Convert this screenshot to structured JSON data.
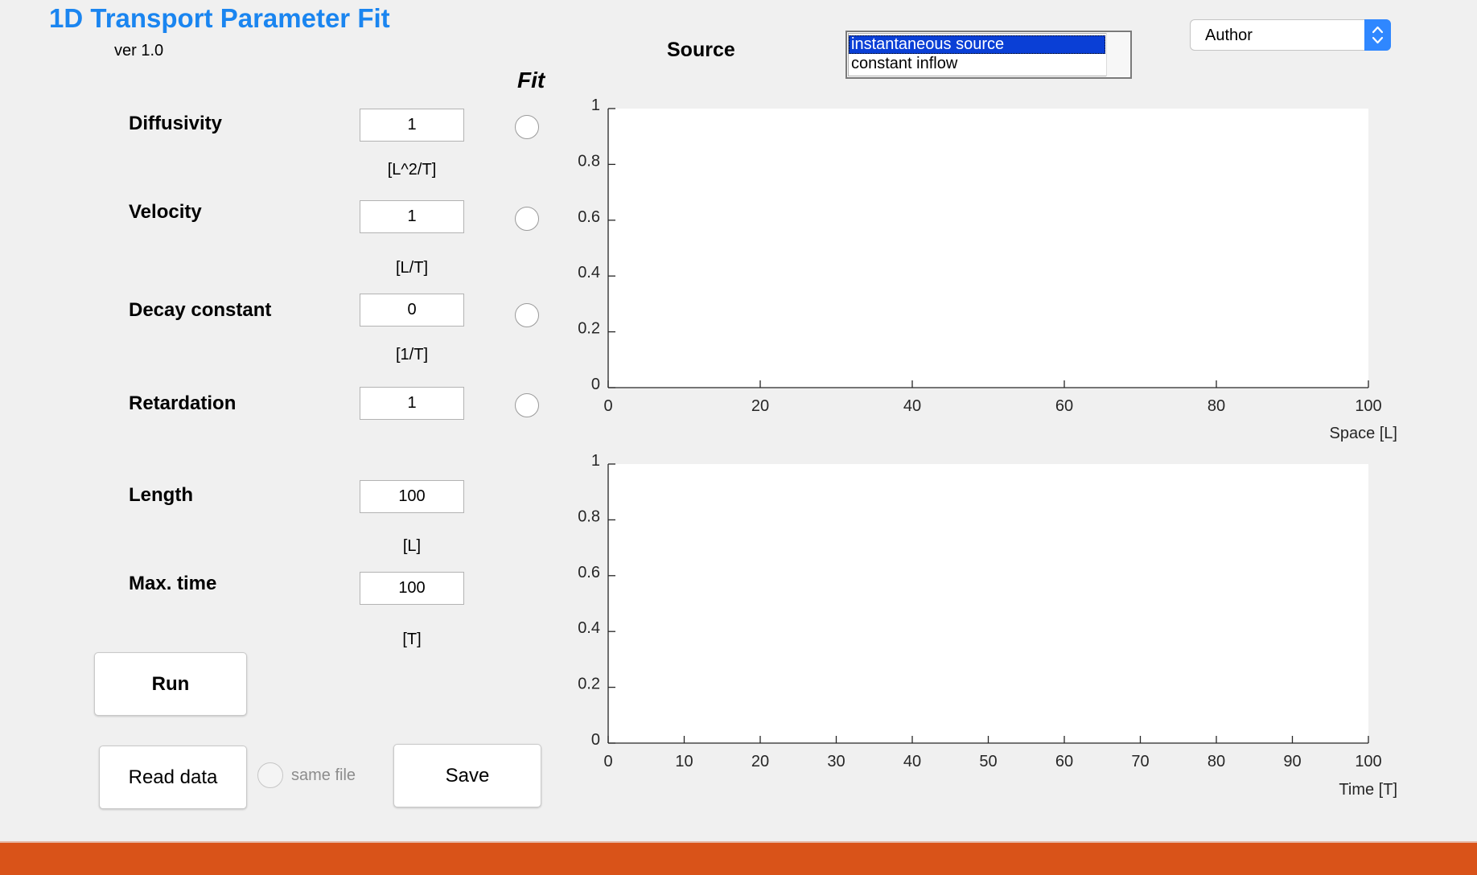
{
  "app": {
    "title": "1D Transport Parameter Fit",
    "version": "ver 1.0"
  },
  "fit_header": "Fit",
  "parameters": [
    {
      "label": "Diffusivity",
      "value": "1",
      "unit": "[L^2/T]",
      "fit_selected": false
    },
    {
      "label": "Velocity",
      "value": "1",
      "unit": "[L/T]",
      "fit_selected": false
    },
    {
      "label": "Decay constant",
      "value": "0",
      "unit": "[1/T]",
      "fit_selected": false
    },
    {
      "label": "Retardation",
      "value": "1",
      "unit": "",
      "fit_selected": false
    },
    {
      "label": "Length",
      "value": "100",
      "unit": "[L]"
    },
    {
      "label": "Max. time",
      "value": "100",
      "unit": "[T]"
    }
  ],
  "source": {
    "label": "Source",
    "options": [
      "instantaneous source",
      "constant inflow"
    ],
    "selected": "instantaneous source"
  },
  "author_select": {
    "value": "Author"
  },
  "buttons": {
    "run": "Run",
    "read_data": "Read data",
    "save": "Save"
  },
  "same_file": {
    "label": "same file",
    "checked": false
  },
  "colors": {
    "title": "#1a85f0",
    "selection": "#0a3fd6",
    "footer": "#d95319",
    "dropdown_arrow": "#2f87ff"
  },
  "chart_data": [
    {
      "type": "line",
      "series": [],
      "xlabel": "Space [L]",
      "ylabel": "",
      "xlim": [
        0,
        100
      ],
      "ylim": [
        0,
        1
      ],
      "xticks": [
        0,
        20,
        40,
        60,
        80,
        100
      ],
      "yticks": [
        0,
        0.2,
        0.4,
        0.6,
        0.8,
        1
      ],
      "xtick_labels": [
        "0",
        "20",
        "40",
        "60",
        "80",
        "100"
      ],
      "ytick_labels": [
        "0",
        "0.2",
        "0.4",
        "0.6",
        "0.8",
        "1"
      ],
      "grid": false
    },
    {
      "type": "line",
      "series": [],
      "xlabel": "Time [T]",
      "ylabel": "",
      "xlim": [
        0,
        100
      ],
      "ylim": [
        0,
        1
      ],
      "xticks": [
        0,
        10,
        20,
        30,
        40,
        50,
        60,
        70,
        80,
        90,
        100
      ],
      "yticks": [
        0,
        0.2,
        0.4,
        0.6,
        0.8,
        1
      ],
      "xtick_labels": [
        "0",
        "10",
        "20",
        "30",
        "40",
        "50",
        "60",
        "70",
        "80",
        "90",
        "100"
      ],
      "ytick_labels": [
        "0",
        "0.2",
        "0.4",
        "0.6",
        "0.8",
        "1"
      ],
      "grid": false
    }
  ]
}
